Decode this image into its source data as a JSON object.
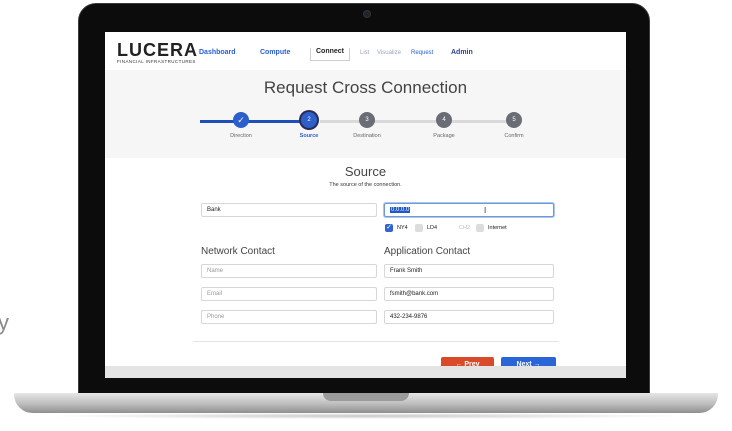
{
  "background_fragment": "y",
  "brand": {
    "name": "LUCERA",
    "subtitle": "FINANCIAL INFRASTRUCTURES"
  },
  "nav": {
    "dashboard": "Dashboard",
    "compute": "Compute",
    "connect": "Connect",
    "list": "List",
    "visualize": "Visualize",
    "request": "Request",
    "admin": "Admin"
  },
  "page_title": "Request Cross Connection",
  "steps": [
    {
      "number": "✓",
      "label": "Direction",
      "state": "done"
    },
    {
      "number": "2",
      "label": "Source",
      "state": "current"
    },
    {
      "number": "3",
      "label": "Destination",
      "state": "pending"
    },
    {
      "number": "4",
      "label": "Package",
      "state": "pending"
    },
    {
      "number": "5",
      "label": "Confirm",
      "state": "pending"
    }
  ],
  "source": {
    "title": "Source",
    "subtitle": "The source of the connection.",
    "bank_value": "Bank",
    "ip_value": "0.0.0.0",
    "locations": {
      "ny4": "NY4",
      "ld4": "LD4",
      "ch2": "CH2",
      "internet": "Internet"
    }
  },
  "network_contact": {
    "title": "Network Contact",
    "name_placeholder": "Name",
    "email_placeholder": "Email",
    "phone_placeholder": "Phone"
  },
  "application_contact": {
    "title": "Application Contact",
    "name_value": "Frank Smith",
    "email_value": "fsmith@bank.com",
    "phone_value": "432-234-9876"
  },
  "buttons": {
    "prev": "← Prev",
    "next": "Next →"
  },
  "colors": {
    "primary": "#2965d6",
    "danger": "#d94a2b"
  }
}
